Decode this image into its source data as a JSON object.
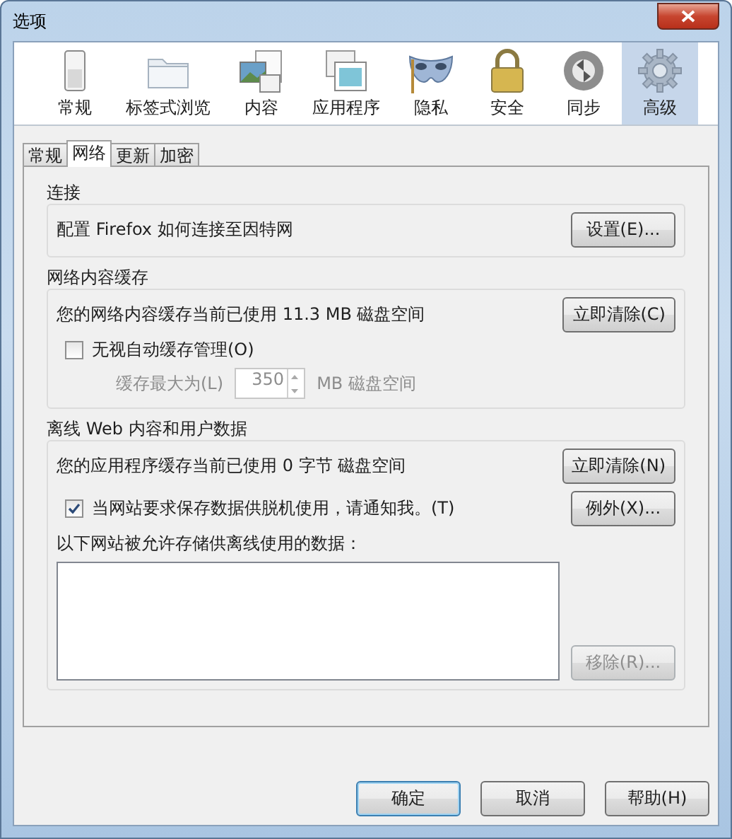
{
  "window": {
    "title": "选项"
  },
  "panes": [
    {
      "label": "常规",
      "selected": false
    },
    {
      "label": "标签式浏览",
      "selected": false
    },
    {
      "label": "内容",
      "selected": false
    },
    {
      "label": "应用程序",
      "selected": false
    },
    {
      "label": "隐私",
      "selected": false
    },
    {
      "label": "安全",
      "selected": false
    },
    {
      "label": "同步",
      "selected": false
    },
    {
      "label": "高级",
      "selected": true
    }
  ],
  "subtabs": [
    {
      "label": "常规",
      "selected": false
    },
    {
      "label": "网络",
      "selected": true
    },
    {
      "label": "更新",
      "selected": false
    },
    {
      "label": "加密",
      "selected": false
    }
  ],
  "connection": {
    "legend": "连接",
    "text": "配置 Firefox 如何连接至因特网",
    "button": "设置(E)..."
  },
  "cache": {
    "legend": "网络内容缓存",
    "text": "您的网络内容缓存当前已使用 11.3 MB 磁盘空间",
    "button": "立即清除(C)",
    "override": {
      "label": "无视自动缓存管理(O)",
      "checked": false
    },
    "limit": {
      "label": "缓存最大为(L)",
      "value": "350",
      "unit": "MB 磁盘空间",
      "disabled": true
    }
  },
  "offline": {
    "legend": "离线 Web 内容和用户数据",
    "text": "您的应用程序缓存当前已使用 0 字节 磁盘空间",
    "clear_button": "立即清除(N)",
    "notify": {
      "label": "当网站要求保存数据供脱机使用，请通知我。(T)",
      "checked": true
    },
    "exceptions_button": "例外(X)...",
    "list_label": "以下网站被允许存储供离线使用的数据：",
    "remove_button": {
      "label": "移除(R)...",
      "disabled": true
    }
  },
  "buttons": [
    {
      "label": "确定",
      "default": true
    },
    {
      "label": "取消",
      "default": false
    },
    {
      "label": "帮助(H)",
      "default": false
    }
  ]
}
